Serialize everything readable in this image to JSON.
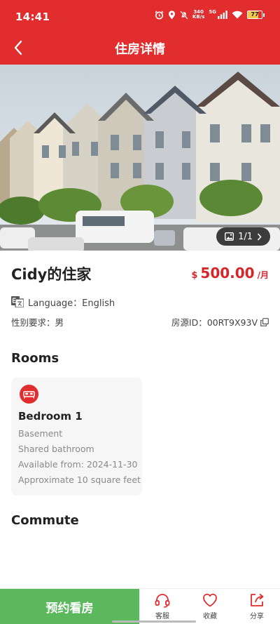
{
  "status_bar": {
    "time": "14:41",
    "net_speed_value": "340",
    "net_speed_unit": "KB/s",
    "network": "5G",
    "battery": "77",
    "battery_level": 0.77,
    "icons": [
      "alarm-icon",
      "location-icon",
      "mute-icon",
      "signal-icon",
      "wifi-icon",
      "battery-icon"
    ]
  },
  "nav": {
    "title": "住房详情",
    "back_icon": "chevron-left-icon"
  },
  "hero": {
    "photo_counter": "1/1",
    "counter_icon": "image-icon",
    "counter_arrow_icon": "chevron-right-icon"
  },
  "listing": {
    "title": "Cidy的住家",
    "price_currency": "$",
    "price_value": "500.00",
    "price_unit": "/月",
    "language_label": "Language：English",
    "gender_label": "性别要求：男",
    "id_label": "房源ID：00RT9X93V"
  },
  "rooms": {
    "section_title": "Rooms",
    "items": [
      {
        "name": "Bedroom 1",
        "details": [
          "Basement",
          "Shared bathroom",
          "Available from: 2024-11-30",
          "Approximate 10 square feet"
        ]
      }
    ]
  },
  "commute": {
    "section_title": "Commute"
  },
  "bottom_bar": {
    "book_label": "预约看房",
    "actions": [
      {
        "label": "客服",
        "icon": "headset-icon"
      },
      {
        "label": "收藏",
        "icon": "heart-icon"
      },
      {
        "label": "分享",
        "icon": "share-icon"
      }
    ]
  },
  "colors": {
    "brand_red": "#e12d2d",
    "price_red": "#d6262a",
    "book_green": "#5cb85c"
  }
}
